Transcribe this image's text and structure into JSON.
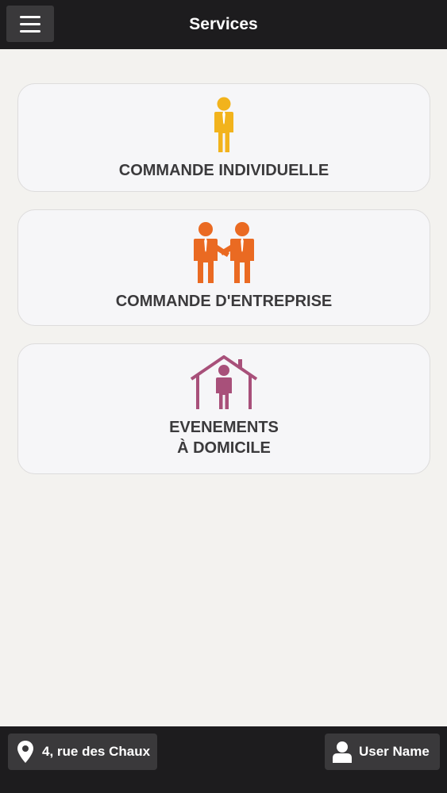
{
  "header": {
    "menu_icon": "hamburger-menu-icon",
    "title": "Services"
  },
  "services": [
    {
      "label_lines": [
        "COMMANDE INDIVIDUELLE"
      ],
      "icon": "person-icon",
      "color": "#f2b31c"
    },
    {
      "label_lines": [
        "COMMANDE D'ENTREPRISE"
      ],
      "icon": "handshake-people-icon",
      "color": "#ea6a22"
    },
    {
      "label_lines": [
        "EVENEMENTS",
        "À DOMICILE"
      ],
      "icon": "person-in-house-icon",
      "color": "#a8507a"
    }
  ],
  "footer": {
    "address_icon": "location-pin-icon",
    "address": "4, rue des Chaux",
    "user_icon": "user-icon",
    "user_name": "User Name"
  },
  "colors": {
    "bar_background": "#1d1c1e",
    "button_background": "#3a393b",
    "page_background": "#f3f2ef",
    "card_background": "#f6f6f8",
    "label_text": "#3b3a3c"
  }
}
